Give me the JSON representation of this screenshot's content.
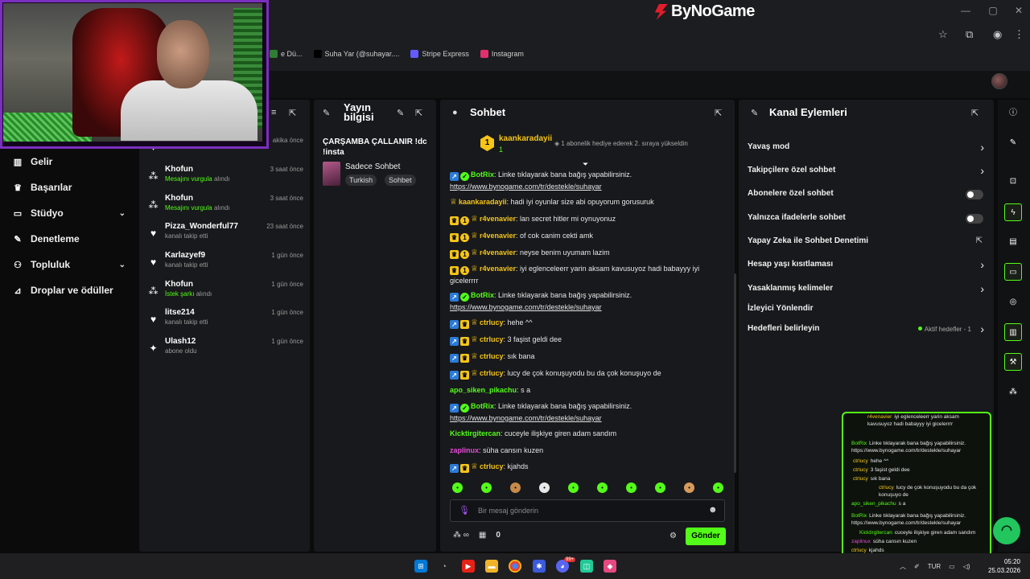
{
  "browser": {
    "brand": "ByNoGame",
    "bookmarks": [
      {
        "label": "e Dü...",
        "color": "#2e7d32"
      },
      {
        "label": "Suha Yar (@suhayar....",
        "color": "#000000"
      },
      {
        "label": "Stripe Express",
        "color": "#635bff"
      },
      {
        "label": "Instagram",
        "color": "#e1306c"
      }
    ]
  },
  "nav": {
    "items": [
      {
        "label": "Gelir",
        "icon": "chart-icon"
      },
      {
        "label": "Başarılar",
        "icon": "trophy-icon"
      },
      {
        "label": "Stüdyo",
        "icon": "studio-icon",
        "chevron": true
      },
      {
        "label": "Denetleme",
        "icon": "wrench-icon"
      },
      {
        "label": "Topluluk",
        "icon": "community-icon",
        "chevron": true
      },
      {
        "label": "Droplar ve ödüller",
        "icon": "drops-icon"
      }
    ]
  },
  "events": {
    "items": [
      {
        "name": "",
        "sub": "kanalı takip etti",
        "time": "akika önce",
        "icon": "heart-icon"
      },
      {
        "name": "Khofun",
        "sub_green": "Mesajını vurgula",
        "sub": "alındı",
        "time": "3 saat önce",
        "icon": "points-icon"
      },
      {
        "name": "Khofun",
        "sub_green": "Mesajını vurgula",
        "sub": "alındı",
        "time": "3 saat önce",
        "icon": "points-icon"
      },
      {
        "name": "Pizza_Wonderful77",
        "sub": "kanalı takip etti",
        "time": "23 saat önce",
        "icon": "heart-icon"
      },
      {
        "name": "Karlazyef9",
        "sub": "kanalı takip etti",
        "time": "1 gün önce",
        "icon": "heart-icon"
      },
      {
        "name": "Khofun",
        "sub_green": "İstek şarkı",
        "sub": "alındı",
        "time": "1 gün önce",
        "icon": "points-icon"
      },
      {
        "name": "litse214",
        "sub": "kanalı takip etti",
        "time": "1 gün önce",
        "icon": "heart-icon"
      },
      {
        "name": "Ulash12",
        "sub": "abone oldu",
        "time": "1 gün önce",
        "icon": "sparkle-icon"
      }
    ]
  },
  "info": {
    "header": "Yayın bilgisi",
    "title": "ÇARŞAMBA ÇALLANIR !dc !insta",
    "category": "Sadece Sohbet",
    "tags": [
      "Turkish",
      "Sohbet"
    ]
  },
  "chat": {
    "header": "Sohbet",
    "pinned": {
      "rank": "1",
      "user": "kaankaradayii",
      "count": "1",
      "text": "1 abonelik hediye ederek 2. sıraya yükseldin"
    },
    "messages": [
      {
        "badges": [
          "blue",
          "verified"
        ],
        "user": "BotRix",
        "color": "#53fc18",
        "text": "Linke tıklayarak bana bağış yapabilirsiniz.",
        "link": "https://www.bynogame.com/tr/destekle/suhayar"
      },
      {
        "badges": [
          "crown"
        ],
        "user": "kaankaradayii",
        "color": "#f5c518",
        "text": "hadi iyi oyunlar size abi opuyorum gorusuruk"
      },
      {
        "badges": [
          "gold",
          "one",
          "crown"
        ],
        "user": "r4venavier",
        "color": "#f5c518",
        "text": "lan secret hitler mi oynuyonuz"
      },
      {
        "badges": [
          "gold",
          "one",
          "crown"
        ],
        "user": "r4venavier",
        "color": "#f5c518",
        "text": "of cok canim cekti amk"
      },
      {
        "badges": [
          "gold",
          "one",
          "crown"
        ],
        "user": "r4venavier",
        "color": "#f5c518",
        "text": "neyse benim uyumam lazim"
      },
      {
        "badges": [
          "gold",
          "one",
          "crown"
        ],
        "user": "r4venavier",
        "color": "#f5c518",
        "text": "iyi eglenceleerr yarin aksam kavusuyoz hadi babayyy iyi gicelerrrr"
      },
      {
        "badges": [
          "blue",
          "verified"
        ],
        "user": "BotRix",
        "color": "#53fc18",
        "text": "Linke tıklayarak bana bağış yapabilirsiniz.",
        "link": "https://www.bynogame.com/tr/destekle/suhayar"
      },
      {
        "badges": [
          "blue",
          "gold",
          "crown"
        ],
        "user": "ctrlucy",
        "color": "#f5c518",
        "text": "hehe ^^"
      },
      {
        "badges": [
          "blue",
          "gold",
          "crown"
        ],
        "user": "ctrlucy",
        "color": "#f5c518",
        "text": "3 faşist geldi dee"
      },
      {
        "badges": [
          "blue",
          "gold",
          "crown"
        ],
        "user": "ctrlucy",
        "color": "#f5c518",
        "text": "sık bana"
      },
      {
        "badges": [
          "blue",
          "gold",
          "crown"
        ],
        "user": "ctrlucy",
        "color": "#f5c518",
        "text": "lucy de çok konuşuyodu bu da çok konuşuyo de"
      },
      {
        "badges": [],
        "user": "apo_siken_pikachu",
        "color": "#53fc18",
        "text": "s a"
      },
      {
        "badges": [
          "blue",
          "verified"
        ],
        "user": "BotRix",
        "color": "#53fc18",
        "text": "Linke tıklayarak bana bağış yapabilirsiniz.",
        "link": "https://www.bynogame.com/tr/destekle/suhayar"
      },
      {
        "badges": [],
        "user": "Kicktirgitercan",
        "color": "#53fc18",
        "text": "cuceyle ilişkiye giren adam sandım"
      },
      {
        "badges": [],
        "user": "zaplinux",
        "color": "#e64bd8",
        "text": "süha cansın kuzen"
      },
      {
        "badges": [
          "blue",
          "gold",
          "crown"
        ],
        "user": "ctrlucy",
        "color": "#f5c518",
        "text": "kjahds"
      }
    ],
    "emotes": [
      "#53fc18",
      "#53fc18",
      "#c68a4a",
      "#e8e8e8",
      "#53fc18",
      "#53fc18",
      "#53fc18",
      "#53fc18",
      "#d69a5a",
      "#53fc18"
    ],
    "placeholder": "Bir mesaj gönderin",
    "send": "Gönder",
    "viewer_count": "0"
  },
  "actions": {
    "header": "Kanal Eylemleri",
    "items": [
      {
        "label": "Yavaş mod",
        "control": "chevron"
      },
      {
        "label": "Takipçilere özel sohbet",
        "control": "chevron"
      },
      {
        "label": "Abonelere özel sohbet",
        "control": "toggle"
      },
      {
        "label": "Yalnızca ifadelerle sohbet",
        "control": "toggle"
      },
      {
        "label": "Yapay Zeka ile Sohbet Denetimi",
        "control": "external"
      },
      {
        "label": "Hesap yaşı kısıtlaması",
        "control": "chevron"
      },
      {
        "label": "Yasaklanmış kelimeler",
        "control": "chevron"
      },
      {
        "label": "İzleyici Yönlendir",
        "control": "none"
      },
      {
        "label": "Hedefleri belirleyin",
        "control": "chevron",
        "extra": "Aktif hedefler - 1"
      }
    ]
  },
  "overlay": {
    "lines": [
      {
        "user": "r4venavier",
        "color": "#f5c518",
        "text": "iyi eglenceleerr yarin aksam kavusuyoz hadi babayyy iyi gicelerrrr"
      },
      {
        "user": "BotRix",
        "color": "#53fc18",
        "text": "Linke tıklayarak bana bağış yapabilirsiniz. https://www.bynogame.com/tr/destekle/suhayar"
      },
      {
        "user": "ctrlucy",
        "color": "#f5c518",
        "text": "hehe ^^"
      },
      {
        "user": "ctrlucy",
        "color": "#f5c518",
        "text": "3 faşist geldi dee"
      },
      {
        "user": "ctrlucy",
        "color": "#f5c518",
        "text": "sık bana"
      },
      {
        "user": "ctrlucy",
        "color": "#f5c518",
        "text": "lucy de çok konuşuyodu bu da çok konuşuyo de"
      },
      {
        "user": "apo_siken_pikachu",
        "color": "#53fc18",
        "text": "s a"
      },
      {
        "user": "BotRix",
        "color": "#53fc18",
        "text": "Linke tıklayarak bana bağış yapabilirsiniz. https://www.bynogame.com/tr/destekle/suhayar"
      },
      {
        "user": "Kicktirgitercan",
        "color": "#53fc18",
        "text": "cuceyle ilişkiye giren adam sandım"
      },
      {
        "user": "zaplinux",
        "color": "#e64bd8",
        "text": "süha cansın kuzen"
      },
      {
        "user": "ctrlucy",
        "color": "#f5c518",
        "text": "kjahds"
      }
    ]
  },
  "taskbar": {
    "lang": "TUR",
    "time": "05:20",
    "date": "25.03.2026",
    "badge": "99+"
  }
}
